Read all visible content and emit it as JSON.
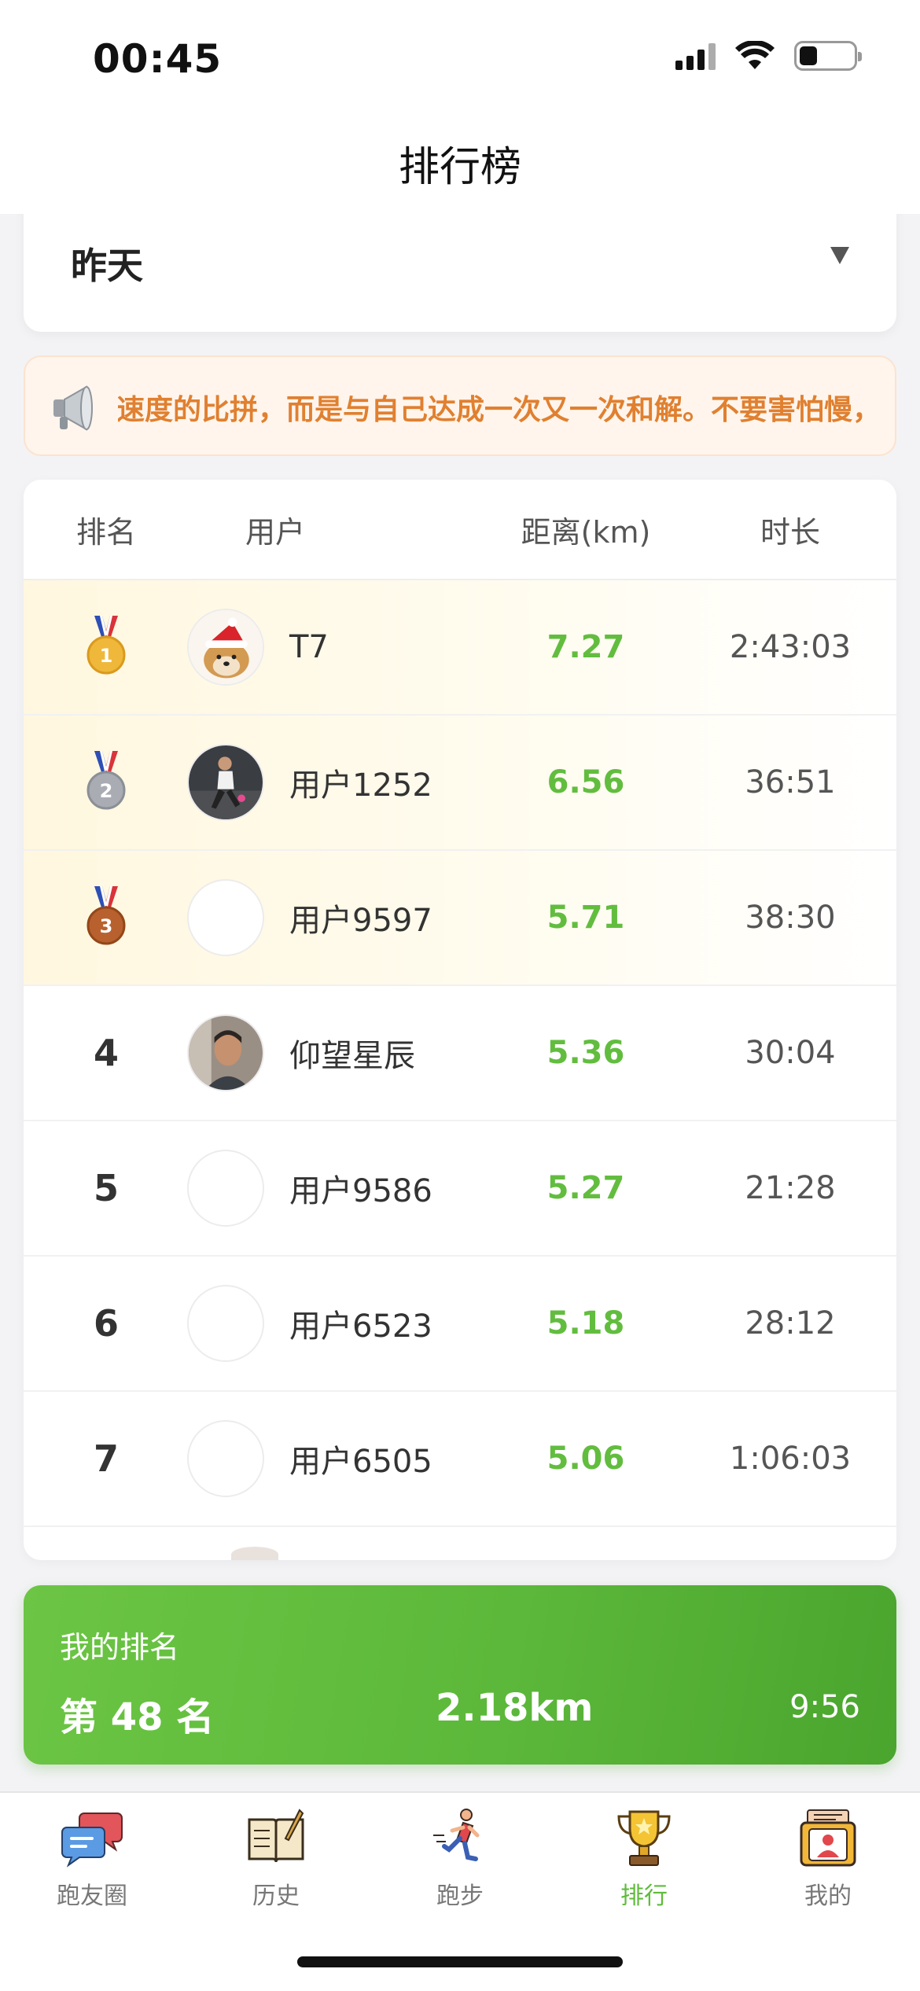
{
  "status_bar": {
    "time": "00:45"
  },
  "header": {
    "title": "排行榜"
  },
  "date_selector": {
    "value": "昨天"
  },
  "notice": {
    "text": "速度的比拼，而是与自己达成一次又一次和解。不要害怕慢，"
  },
  "table": {
    "headers": {
      "rank": "排名",
      "user": "用户",
      "distance": "距离(km)",
      "duration": "时长"
    },
    "rows": [
      {
        "rank": "1",
        "name": "T7",
        "distance": "7.27",
        "duration": "2:43:03",
        "medal": "gold",
        "avatar": "dog-santa-hat"
      },
      {
        "rank": "2",
        "name": "用户1252",
        "distance": "6.56",
        "duration": "36:51",
        "medal": "silver",
        "avatar": "runner-photo"
      },
      {
        "rank": "3",
        "name": "用户9597",
        "distance": "5.71",
        "duration": "38:30",
        "medal": "bronze",
        "avatar": "empty"
      },
      {
        "rank": "4",
        "name": "仰望星辰",
        "distance": "5.36",
        "duration": "30:04",
        "avatar": "person-photo"
      },
      {
        "rank": "5",
        "name": "用户9586",
        "distance": "5.27",
        "duration": "21:28",
        "avatar": "empty"
      },
      {
        "rank": "6",
        "name": "用户6523",
        "distance": "5.18",
        "duration": "28:12",
        "avatar": "empty"
      },
      {
        "rank": "7",
        "name": "用户6505",
        "distance": "5.06",
        "duration": "1:06:03",
        "avatar": "empty"
      }
    ]
  },
  "my_rank": {
    "label": "我的排名",
    "rank_text": "第 48 名",
    "distance": "2.18km",
    "duration": "9:56"
  },
  "tabbar": {
    "items": [
      {
        "label": "跑友圈",
        "icon": "chat-bubbles-icon",
        "active": false
      },
      {
        "label": "历史",
        "icon": "book-icon",
        "active": false
      },
      {
        "label": "跑步",
        "icon": "runner-icon",
        "active": false
      },
      {
        "label": "排行",
        "icon": "trophy-icon",
        "active": true
      },
      {
        "label": "我的",
        "icon": "profile-card-icon",
        "active": false
      }
    ]
  },
  "colors": {
    "accent_green": "#62bd3f",
    "notice_orange": "#e08030",
    "gold": "#f0b83a",
    "silver": "#a9acb3",
    "bronze": "#b8612f"
  }
}
